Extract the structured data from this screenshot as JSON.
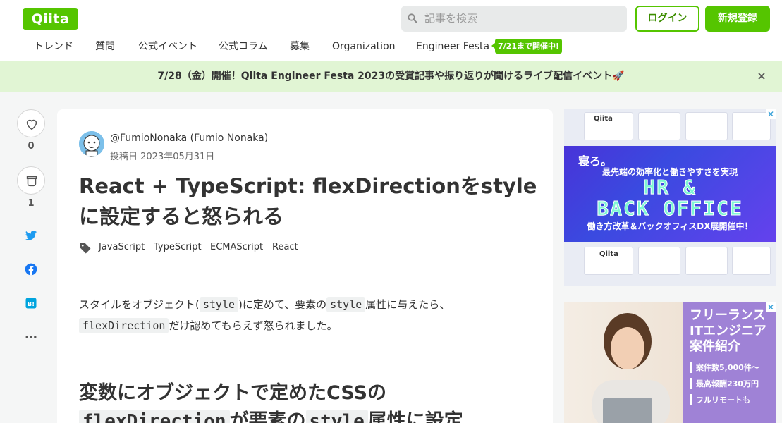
{
  "header": {
    "logo": "Qiita",
    "search_placeholder": "記事を検索",
    "login_label": "ログイン",
    "signup_label": "新規登録",
    "nav": [
      "トレンド",
      "質問",
      "公式イベント",
      "公式コラム",
      "募集",
      "Organization",
      "Engineer Festa"
    ],
    "nav_badge": "7/21まで開催中!"
  },
  "banner": {
    "text": "7/28（金）開催！Qiita Engineer Festa 2023の受賞記事や振り返りが聞けるライブ配信イベント🚀"
  },
  "actions": {
    "like_count": "0",
    "stock_count": "1"
  },
  "article": {
    "author": "@FumioNonaka (Fumio Nonaka)",
    "posted": "投稿日 2023年05月31日",
    "title": "React + TypeScript: flexDirectionをstyleに設定すると怒られる",
    "tags": [
      "JavaScript",
      "TypeScript",
      "ECMAScript",
      "React"
    ],
    "para_p1": "スタイルをオブジェクト(",
    "para_code1": "style",
    "para_p2": ")に定めて、要素の",
    "para_code2": "style",
    "para_p3": "属性に与えたら、",
    "para_code3": "flexDirection",
    "para_p4": "だけ認めてもらえず怒られました。",
    "h2_p1": "変数にオブジェクトで定めたCSSの",
    "h2_code1": "flexDirection",
    "h2_p2": "が要素の",
    "h2_code2": "style",
    "h2_p3": "属性に設定"
  },
  "ads": {
    "ad1_brand": "Qiita",
    "ad1_sleep": "寝ろ。",
    "ad1_subtitle": "最先端の効率化と働きやすさを実現",
    "ad1_big1": "HR &",
    "ad1_big2": "BACK OFFICE",
    "ad1_sub2": "働き方改革＆バックオフィスDX展開催中！",
    "ad2_title": "フリーランスITエンジニア案件紹介",
    "ad2_items": [
      "案件数5,000件〜",
      "最高報酬230万円",
      "フルリモートも"
    ]
  },
  "colors": {
    "brand_green": "#55c500",
    "banner_bg": "#e1f5d4"
  }
}
